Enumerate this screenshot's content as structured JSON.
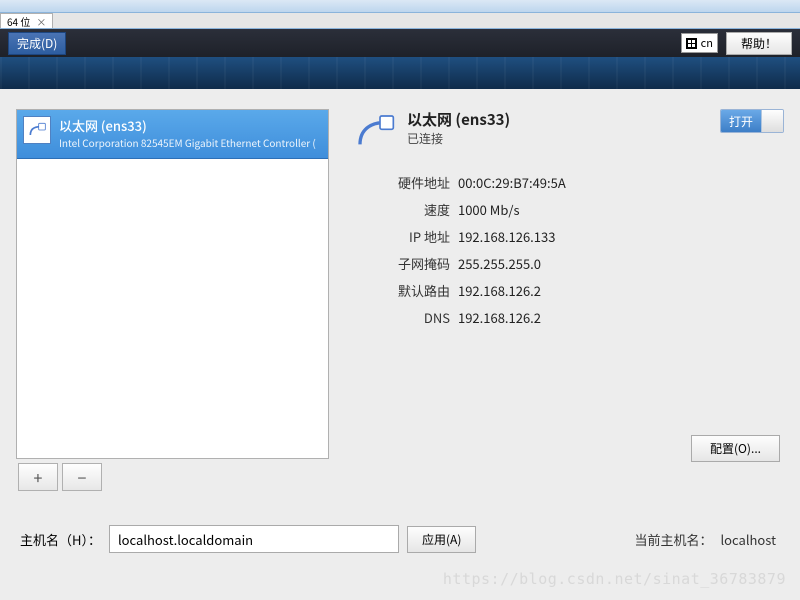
{
  "tab": {
    "label": "64 位",
    "close": "×"
  },
  "topbar": {
    "done": "完成(D)",
    "ime": "cn",
    "help": "帮助！"
  },
  "sidebar": {
    "nic": {
      "title": "以太网 (ens33)",
      "subtitle": "Intel Corporation 82545EM Gigabit Ethernet Controller ("
    },
    "buttons": {
      "add": "+",
      "remove": "−"
    }
  },
  "details": {
    "title": "以太网 (ens33)",
    "status": "已连接",
    "toggle": "打开",
    "rows": {
      "hwaddr": {
        "k": "硬件地址",
        "v": "00:0C:29:B7:49:5A"
      },
      "speed": {
        "k": "速度",
        "v": "1000 Mb/s"
      },
      "ip": {
        "k": "IP 地址",
        "v": "192.168.126.133"
      },
      "mask": {
        "k": "子网掩码",
        "v": "255.255.255.0"
      },
      "gateway": {
        "k": "默认路由",
        "v": "192.168.126.2"
      },
      "dns": {
        "k": "DNS",
        "v": "192.168.126.2"
      }
    },
    "configure": "配置(O)..."
  },
  "hostname": {
    "label": "主机名（H）：",
    "value": "localhost.localdomain",
    "apply": "应用(A)",
    "current_label": "当前主机名：",
    "current_value": "localhost"
  },
  "watermark": "https://blog.csdn.net/sinat_36783879"
}
